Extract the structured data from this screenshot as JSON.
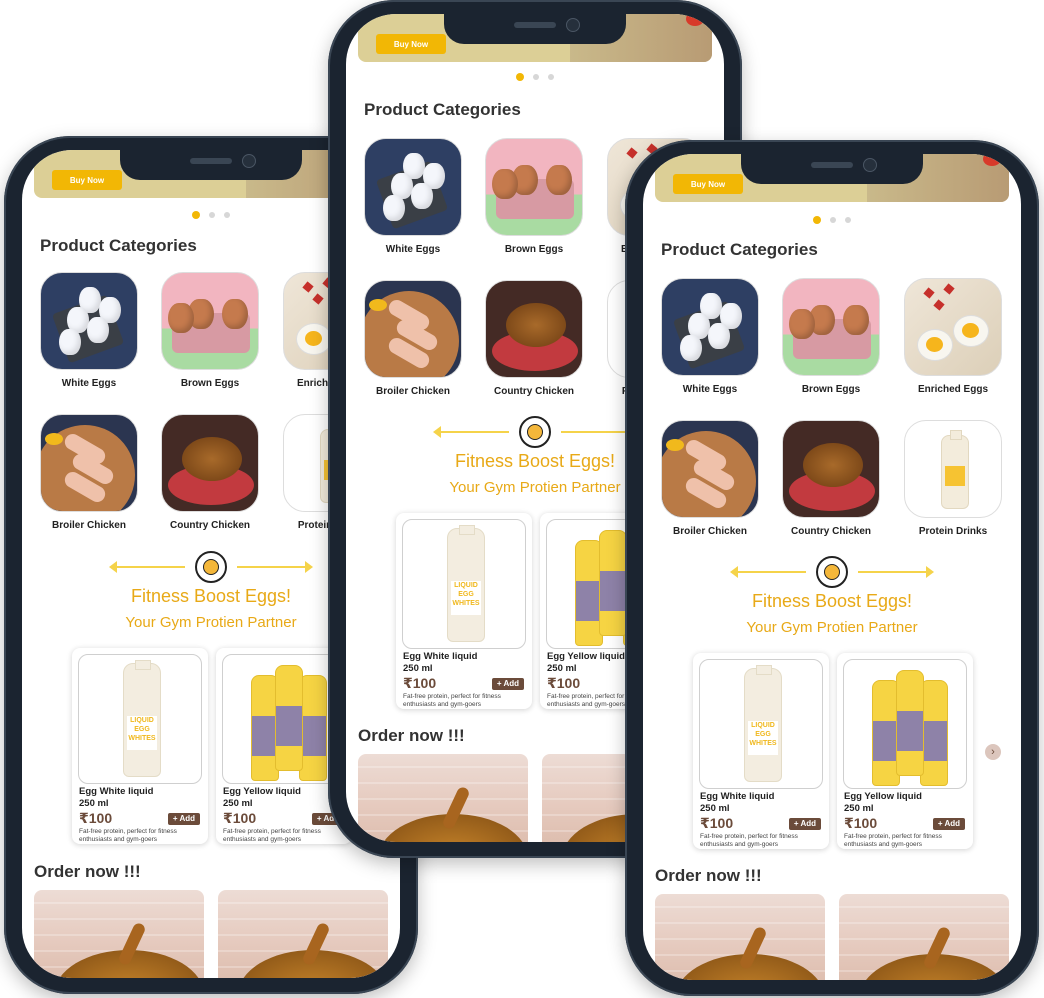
{
  "banner": {
    "buy_now": "Buy Now"
  },
  "sections": {
    "product_categories": "Product Categories",
    "order_now": "Order now !!!"
  },
  "categories": [
    {
      "label": "White Eggs",
      "icon": "white-eggs-image"
    },
    {
      "label": "Brown Eggs",
      "icon": "brown-eggs-image"
    },
    {
      "label": "Enriched Eggs",
      "icon": "enriched-eggs-image"
    },
    {
      "label": "Broiler Chicken",
      "icon": "broiler-chicken-image"
    },
    {
      "label": "Country Chicken",
      "icon": "country-chicken-image"
    },
    {
      "label": "Protein Drinks",
      "icon": "protein-drinks-image"
    }
  ],
  "promo": {
    "title": "Fitness Boost Eggs!",
    "subtitle": "Your Gym Protien Partner"
  },
  "products": [
    {
      "name": "Egg White liquid",
      "qty": "250 ml",
      "price": "₹100",
      "add": "+ Add",
      "desc": "Fat-free protein, perfect for fitness enthusiasts and gym-goers",
      "bottle_text": [
        "LIQUID",
        "EGG",
        "WHITES"
      ]
    },
    {
      "name": "Egg Yellow liquid",
      "qty": "250 ml",
      "price": "₹100",
      "add": "+ Add",
      "desc": "Fat-free protein, perfect for fitness enthusiasts and gym-goers"
    }
  ],
  "colors": {
    "accent": "#f2b705",
    "promo": "#e8a917",
    "brown_button": "#6b4b3a",
    "phone_frame": "#1b2430"
  }
}
